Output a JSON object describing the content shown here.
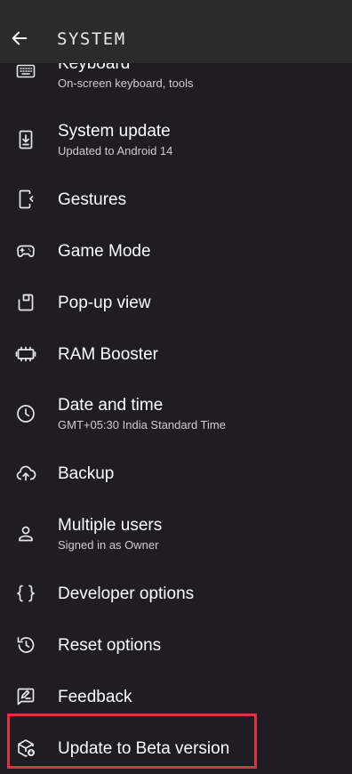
{
  "header": {
    "title": "SYSTEM"
  },
  "items": [
    {
      "id": "keyboard",
      "icon": "keyboard-icon",
      "label": "Keyboard",
      "sub": "On-screen keyboard, tools"
    },
    {
      "id": "system-update",
      "icon": "system-update-icon",
      "label": "System update",
      "sub": "Updated to Android 14"
    },
    {
      "id": "gestures",
      "icon": "gestures-icon",
      "label": "Gestures"
    },
    {
      "id": "game-mode",
      "icon": "gamepad-icon",
      "label": "Game Mode"
    },
    {
      "id": "popup-view",
      "icon": "popup-view-icon",
      "label": "Pop-up view"
    },
    {
      "id": "ram-booster",
      "icon": "memory-icon",
      "label": "RAM Booster"
    },
    {
      "id": "date-time",
      "icon": "clock-icon",
      "label": "Date and time",
      "sub": "GMT+05:30 India Standard Time"
    },
    {
      "id": "backup",
      "icon": "cloud-upload-icon",
      "label": "Backup"
    },
    {
      "id": "multiple-users",
      "icon": "person-icon",
      "label": "Multiple users",
      "sub": "Signed in as Owner"
    },
    {
      "id": "developer-options",
      "icon": "braces-icon",
      "label": "Developer options"
    },
    {
      "id": "reset-options",
      "icon": "history-icon",
      "label": "Reset options"
    },
    {
      "id": "feedback",
      "icon": "feedback-icon",
      "label": "Feedback"
    },
    {
      "id": "update-beta",
      "icon": "beta-update-icon",
      "label": "Update to Beta version"
    }
  ],
  "colors": {
    "background": "#1f1d23",
    "header": "#2b2b2b",
    "highlight": "#e0313f"
  }
}
